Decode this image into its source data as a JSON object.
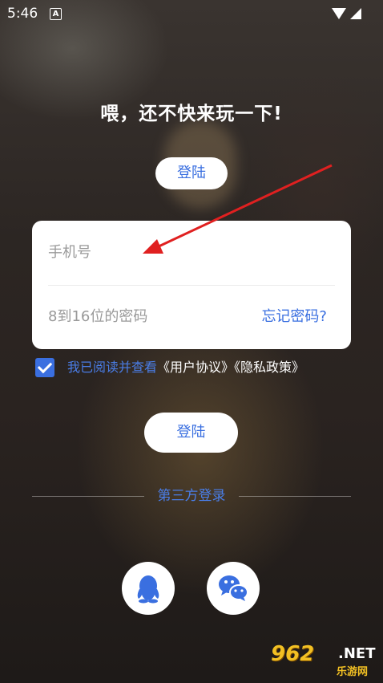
{
  "status_bar": {
    "time": "5:46",
    "notification_icon": "a-icon",
    "wifi_icon": "wifi-icon",
    "signal_icon": "signal-icon"
  },
  "headline": "喂，还不快来玩一下!",
  "top_button": "登陆",
  "form": {
    "phone_placeholder": "手机号",
    "password_placeholder": "8到16位的密码",
    "forgot_link": "忘记密码?"
  },
  "agreement": {
    "checked": true,
    "prefix": "我已阅读并查看",
    "user_agreement": "《用户协议》",
    "privacy_policy": "《隐私政策》"
  },
  "login_button": "登陆",
  "third_party": {
    "label": "第三方登录",
    "providers": [
      "qq-icon",
      "wechat-icon"
    ]
  },
  "watermark": {
    "number": "962",
    "domain": ".NET",
    "site_name": "乐游网"
  },
  "colors": {
    "accent": "#3a6fe0",
    "link": "#4a7ee8",
    "annotation_arrow": "#e02020",
    "watermark": "#f2c023"
  }
}
